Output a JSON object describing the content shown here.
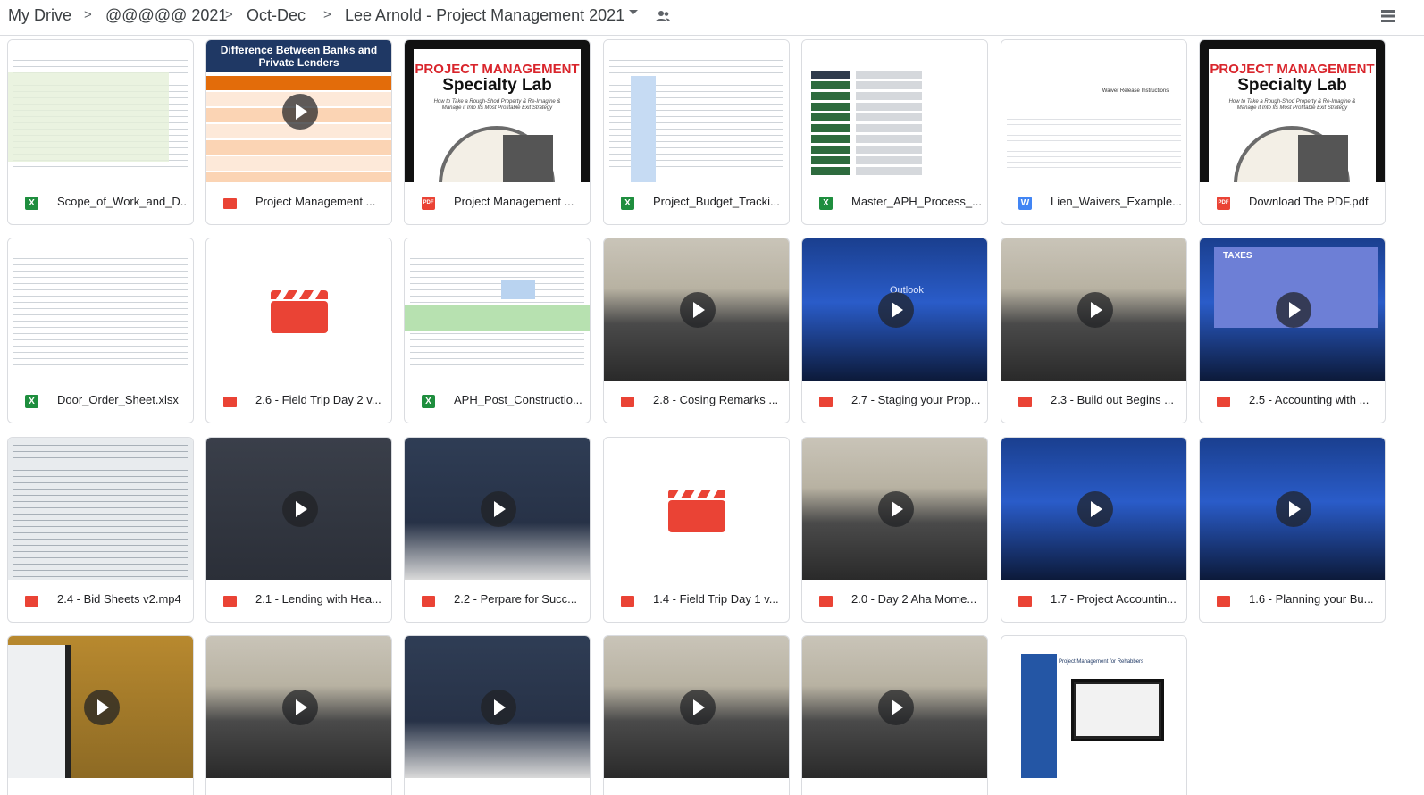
{
  "breadcrumb": {
    "items": [
      "My Drive",
      "@@@@@ 2021",
      "Oct-Dec",
      "Lee Arnold - Project Management 2021"
    ],
    "separator": ">"
  },
  "thumb_text": {
    "banks_title": "Difference Between Banks and Private Lenders",
    "pm_title": "PROJECT MANAGEMENT",
    "pm_sub": "Specialty Lab",
    "pm_tag": "How to Take a Rough-Shod Property & Re-Imagine & Manage it Into Its Most Profitable Exit Strategy",
    "waiver_title": "Waiver Release Instructions",
    "outlook": "Outlook",
    "taxes": "TAXES",
    "pm_rehab": "Project Management for Rehabbers"
  },
  "files": [
    {
      "name": "Scope_of_Work_and_D...",
      "type": "xls",
      "thumb": "sheet"
    },
    {
      "name": "Project Management ...",
      "type": "vid",
      "thumb": "banks"
    },
    {
      "name": "Project Management ...",
      "type": "pdf",
      "thumb": "pmlab"
    },
    {
      "name": "Project_Budget_Tracki...",
      "type": "xls",
      "thumb": "sheet"
    },
    {
      "name": "Master_APH_Process_...",
      "type": "xls",
      "thumb": "process"
    },
    {
      "name": "Lien_Waivers_Example...",
      "type": "doc",
      "thumb": "waiver"
    },
    {
      "name": "Download The PDF.pdf",
      "type": "pdf",
      "thumb": "pmlab"
    },
    {
      "name": "Door_Order_Sheet.xlsx",
      "type": "xls",
      "thumb": "sheet"
    },
    {
      "name": "2.6 - Field Trip Day 2 v...",
      "type": "vid",
      "thumb": "clap"
    },
    {
      "name": "APH_Post_Constructio...",
      "type": "xls",
      "thumb": "sheetgreen"
    },
    {
      "name": "2.8 - Cosing Remarks ...",
      "type": "vid",
      "thumb": "room"
    },
    {
      "name": "2.7 - Staging your Prop...",
      "type": "vid",
      "thumb": "blue"
    },
    {
      "name": "2.3 - Build out Begins ...",
      "type": "vid",
      "thumb": "room"
    },
    {
      "name": "2.5 - Accounting with ...",
      "type": "vid",
      "thumb": "taxes"
    },
    {
      "name": "2.4 - Bid Sheets v2.mp4",
      "type": "vid",
      "thumb": "sheetvid"
    },
    {
      "name": "2.1 - Lending with Hea...",
      "type": "vid",
      "thumb": "dark"
    },
    {
      "name": "2.2 - Perpare for Succ...",
      "type": "vid",
      "thumb": "person"
    },
    {
      "name": "1.4 - Field Trip Day 1 v...",
      "type": "vid",
      "thumb": "clap"
    },
    {
      "name": "2.0 - Day 2 Aha Mome...",
      "type": "vid",
      "thumb": "room"
    },
    {
      "name": "1.7 - Project Accountin...",
      "type": "vid",
      "thumb": "blue"
    },
    {
      "name": "1.6 - Planning your Bu...",
      "type": "vid",
      "thumb": "blue"
    },
    {
      "name": "",
      "type": "vid",
      "thumb": "phone"
    },
    {
      "name": "",
      "type": "vid",
      "thumb": "room"
    },
    {
      "name": "",
      "type": "vid",
      "thumb": "person"
    },
    {
      "name": "",
      "type": "vid",
      "thumb": "room"
    },
    {
      "name": "",
      "type": "vid",
      "thumb": "room"
    },
    {
      "name": "",
      "type": "img",
      "thumb": "rehab"
    }
  ],
  "icons": {
    "dropdown": "chevron-down-icon",
    "shared": "people-icon",
    "view": "list-view-icon"
  },
  "colors": {
    "excel": "#1e8e3e",
    "word": "#4285f4",
    "pdf": "#ea4335",
    "video": "#ea4335"
  }
}
